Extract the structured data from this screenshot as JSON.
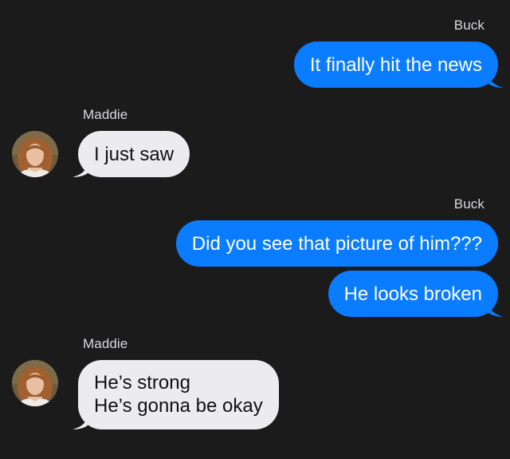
{
  "colors": {
    "background": "#1b1b1c",
    "outgoing_bubble": "#0a7cff",
    "incoming_bubble": "#ececf0",
    "sender_label": "#d9d9de"
  },
  "messages": [
    {
      "sender": "Buck",
      "direction": "outgoing",
      "text": "It finally hit the news"
    },
    {
      "sender": "Maddie",
      "direction": "incoming",
      "text": "I just saw"
    },
    {
      "sender": "Buck",
      "direction": "outgoing",
      "text": "Did you see that picture of him???"
    },
    {
      "sender": "Buck",
      "direction": "outgoing",
      "text": "He looks broken"
    },
    {
      "sender": "Maddie",
      "direction": "incoming",
      "lines": [
        "He’s strong",
        "He’s gonna be okay"
      ]
    }
  ],
  "avatars": {
    "maddie": "avatar-photo-icon"
  }
}
